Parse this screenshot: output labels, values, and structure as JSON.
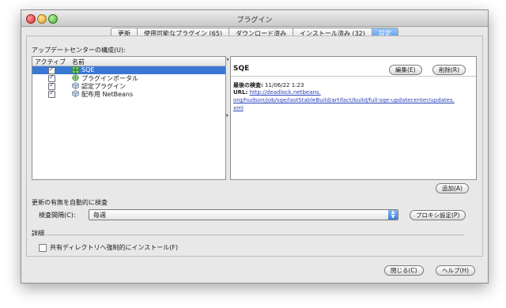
{
  "window": {
    "title": "プラグイン"
  },
  "tabs": [
    {
      "label": "更新"
    },
    {
      "label": "使用可能なプラグイン (65)"
    },
    {
      "label": "ダウンロード済み"
    },
    {
      "label": "インストール済み (32)"
    },
    {
      "label": "設定"
    }
  ],
  "selected_tab": "設定",
  "update_centers": {
    "section_label": "アップデートセンターの構成(U):",
    "columns": [
      "アクティブ",
      "名前"
    ],
    "rows": [
      {
        "checked": true,
        "name": "SQE",
        "icon": "update-center-icon",
        "selected": true
      },
      {
        "checked": true,
        "name": "プラグインポータル",
        "icon": "globe-icon",
        "selected": false
      },
      {
        "checked": true,
        "name": "認定プラグイン",
        "icon": "cube-icon",
        "selected": false
      },
      {
        "checked": true,
        "name": "配布用 NetBeans",
        "icon": "cube-icon",
        "selected": false
      }
    ]
  },
  "detail": {
    "name": "SQE",
    "edit_label": "編集(E)",
    "delete_label": "削除(R)",
    "last_check_label": "最後の検査:",
    "last_check_value": "11/06/22 1:23",
    "url_label": "URL:",
    "url_line1": "http://deadlock.netbeans.",
    "url_line2": "org/hudson/job/sqe/lastStableBuild/artifact/build/full-sqe-updatecenter/updates.",
    "url_line3": "xml"
  },
  "add_label": "追加(A)",
  "auto_check": {
    "section_label": "更新の有無を自動的に検査",
    "interval_label": "検査間隔(C):",
    "interval_value": "毎週",
    "proxy_label": "プロキシ設定(P)"
  },
  "details": {
    "section_label": "詳細",
    "shared_install_label": "共有ディレクトリへ強制的にインストール(F)",
    "shared_install_checked": false
  },
  "footer": {
    "close_label": "閉じる(C)",
    "help_label": "ヘルプ(H)"
  },
  "colors": {
    "selection": "#3b78d6",
    "link": "#2a43b8"
  }
}
